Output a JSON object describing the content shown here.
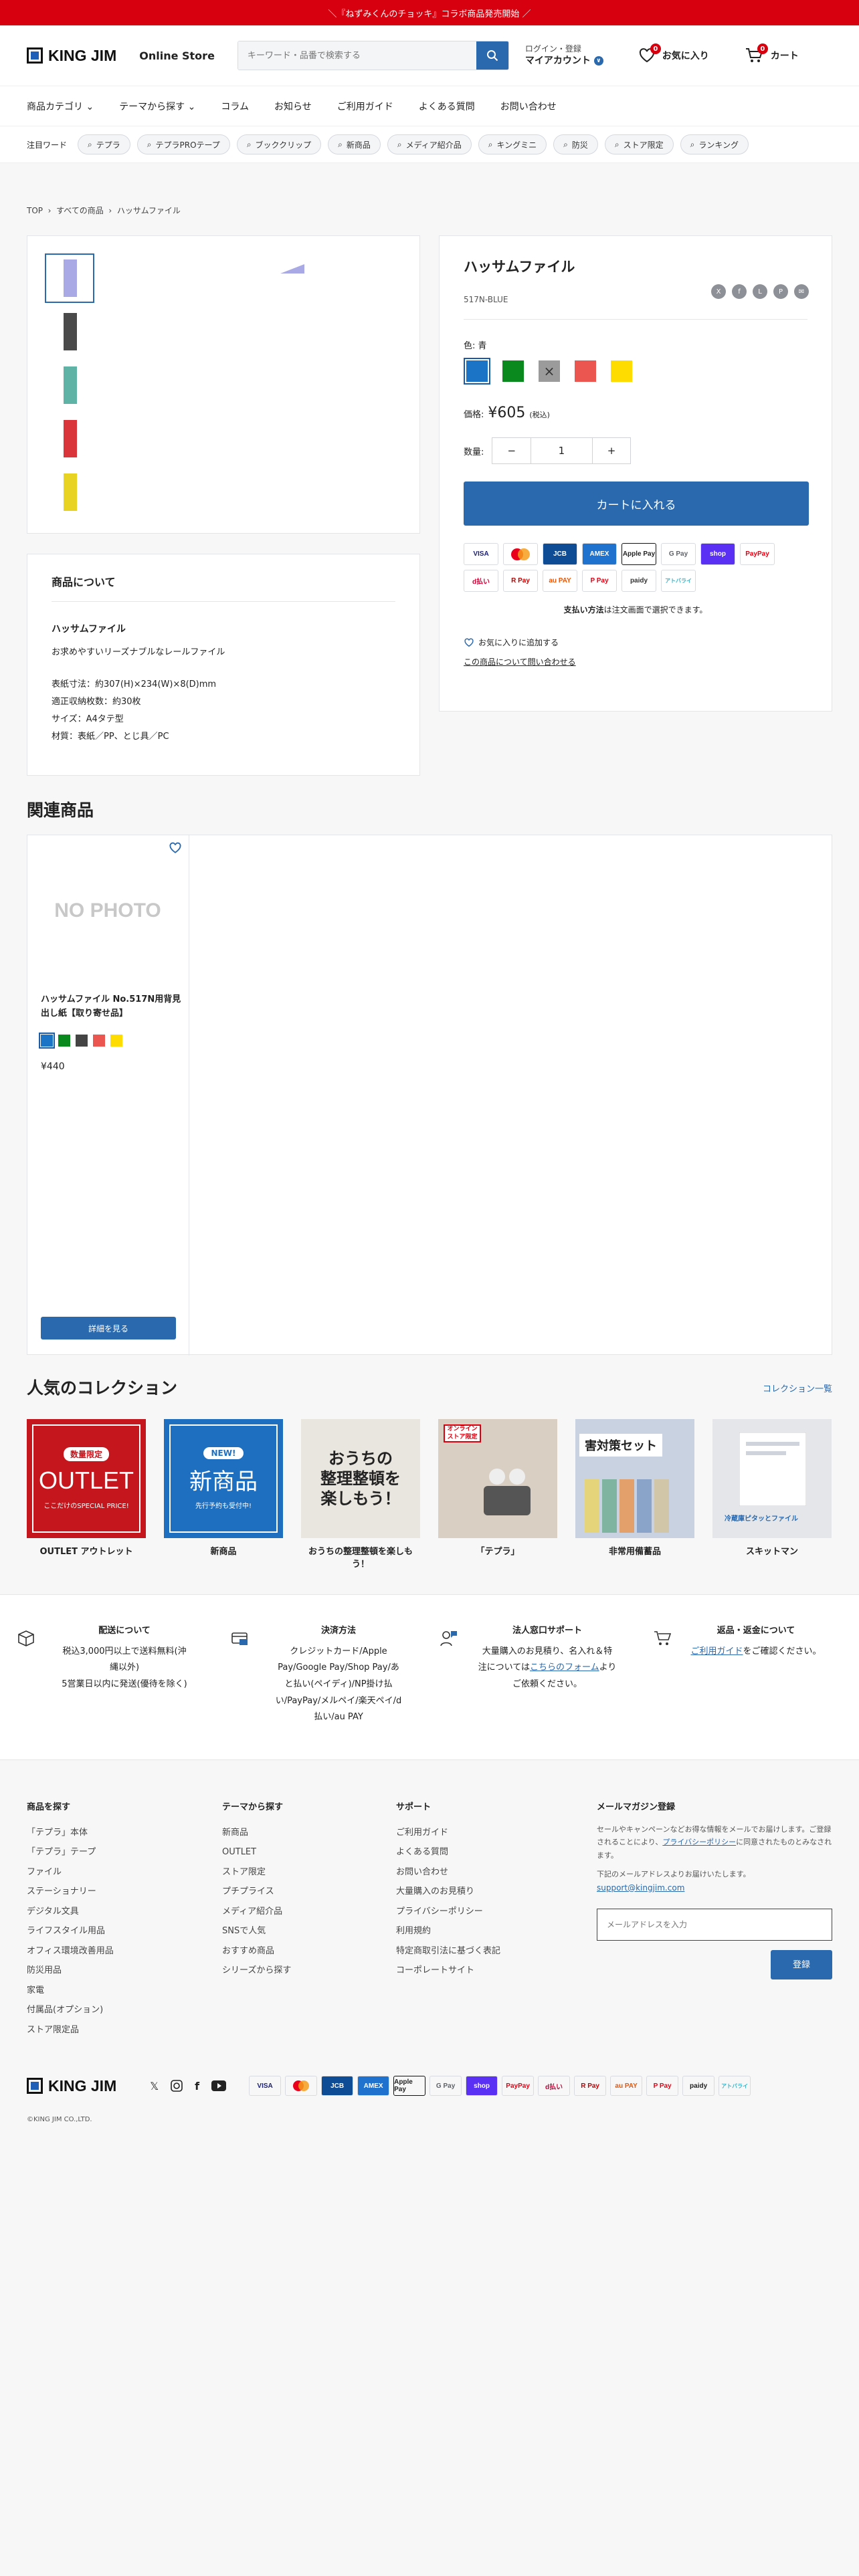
{
  "announcement": "＼『ねずみくんのチョッキ』コラボ商品発売開始 ／",
  "header": {
    "brand": "KING JIM",
    "store": "Online Store",
    "search_placeholder": "キーワード・品番で検索する",
    "account_line1": "ログイン・登録",
    "account_line2": "マイアカウント",
    "account_badge": "∨",
    "wishlist_label": "お気に入り",
    "wishlist_count": "0",
    "cart_label": "カート",
    "cart_count": "0"
  },
  "nav": [
    "商品カテゴリ",
    "テーマから探す",
    "コラム",
    "お知らせ",
    "ご利用ガイド",
    "よくある質問",
    "お問い合わせ"
  ],
  "keywords": {
    "label": "注目ワード",
    "items": [
      "テプラ",
      "テプラPROテープ",
      "ブッククリップ",
      "新商品",
      "メディア紹介品",
      "キングミニ",
      "防災",
      "ストア限定",
      "ランキング"
    ]
  },
  "breadcrumb": [
    "TOP",
    "すべての商品",
    "ハッサムファイル"
  ],
  "product": {
    "title": "ハッサムファイル",
    "sku": "517N-BLUE",
    "color_label": "色: 青",
    "price_label": "価格:",
    "price": "¥605",
    "tax": "(税込)",
    "qty_label": "数量:",
    "qty": "1",
    "add_to_cart": "カートに入れる",
    "payment_note_bold": "支払い方法",
    "payment_note": "は注文画面で選択できます。",
    "add_favorite": "お気に入りに追加する",
    "inquiry": "この商品について問い合わせる",
    "swatches": [
      {
        "color": "#1b74c6",
        "selected": true
      },
      {
        "color": "#0a8a1e"
      },
      {
        "color": "#9b9b9b",
        "soldout": true
      },
      {
        "color": "#ec5650"
      },
      {
        "color": "#ffdc00"
      }
    ],
    "thumb_colors": [
      "#a9a9e6",
      "#4a4a4a",
      "#5fb3a6",
      "#d9353b",
      "#e8d322"
    ],
    "payment_icons": [
      "VISA",
      "MC",
      "JCB",
      "AMEX",
      "Apple Pay",
      "G Pay",
      "shop",
      "PayPay",
      "d払い",
      "R Pay",
      "au PAY",
      "P Pay",
      "paidy",
      "アトバライ"
    ]
  },
  "about": {
    "heading": "商品について",
    "name": "ハッサムファイル",
    "desc": "お求めやすいリーズナブルなレールファイル",
    "spec1": "表紙寸法：約307(H)×234(W)×8(D)mm",
    "spec2": "適正収納枚数：約30枚",
    "spec3": "サイズ：A4タテ型",
    "spec4": "材質：表紙／PP、とじ具／PC"
  },
  "related": {
    "heading": "関連商品",
    "noimg": "NO PHOTO",
    "name": "ハッサムファイル No.517N用背見出し紙【取り寄せ品】",
    "price": "¥440",
    "button": "詳細を見る",
    "swatches": [
      "#1b74c6",
      "#0a8a1e",
      "#444444",
      "#ec5650",
      "#ffdc00"
    ]
  },
  "collections": {
    "heading": "人気のコレクション",
    "all": "コレクション一覧",
    "items": [
      {
        "name": "OUTLET アウトレット",
        "img1": "数量限定",
        "img2": "OUTLET",
        "img3": "ここだけのSPECIAL PRICE!"
      },
      {
        "name": "新商品",
        "img1": "NEW!",
        "img2": "新商品",
        "img3": "先行予約も受付中!"
      },
      {
        "name": "おうちの整理整頓を楽しもう！",
        "img1": "おうちの",
        "img2": "整理整頓を",
        "img3": "楽しもう！"
      },
      {
        "name": "「テプラ」",
        "img1": "オンラインストア限定"
      },
      {
        "name": "非常用備蓄品",
        "img1": "害対策セット"
      },
      {
        "name": "スキットマン",
        "img1": "冷蔵庫ピタッとファイル"
      }
    ]
  },
  "services": [
    {
      "title": "配送について",
      "l1": "税込3,000円以上で送料無料(沖",
      "l2": "縄以外)",
      "l3": "5営業日以内に発送(優待を除く)"
    },
    {
      "title": "決済方法",
      "l1": "クレジットカード/Apple",
      "l2": "Pay/Google Pay/Shop Pay/あ",
      "l3": "と払い(ペイディ)/NP掛け払",
      "l4": "い/PayPay/メルペイ/楽天ペイ/d",
      "l5": "払い/au PAY"
    },
    {
      "title": "法人窓口サポート",
      "l1": "大量購入のお見積り、名入れ＆特",
      "l2a": "注については",
      "link": "こちらのフォーム",
      "l2b": "より",
      "l3": "ご依頼ください。"
    },
    {
      "title": "返品・返金について",
      "link": "ご利用ガイド",
      "l1": "をご確認ください。"
    }
  ],
  "footer": {
    "c1": {
      "title": "商品を探す",
      "items": [
        "「テプラ」本体",
        "「テプラ」テープ",
        "ファイル",
        "ステーショナリー",
        "デジタル文具",
        "ライフスタイル用品",
        "オフィス環境改善用品",
        "防災用品",
        "家電",
        "付属品(オプション)",
        "ストア限定品"
      ]
    },
    "c2": {
      "title": "テーマから探す",
      "items": [
        "新商品",
        "OUTLET",
        "ストア限定",
        "プチプライス",
        "メディア紹介品",
        "SNSで人気",
        "おすすめ商品",
        "シリーズから探す"
      ]
    },
    "c3": {
      "title": "サポート",
      "items": [
        "ご利用ガイド",
        "よくある質問",
        "お問い合わせ",
        "大量購入のお見積り",
        "プライバシーポリシー",
        "利用規約",
        "特定商取引法に基づく表記",
        "コーポレートサイト"
      ]
    },
    "news": {
      "title": "メールマガジン登録",
      "t1": "セールやキャンペーンなどお得な情報をメールでお届けします。ご登録されることにより、",
      "policy": "プライバシーポリシー",
      "t2": "に同意されたものとみなされます。",
      "t3": "下記のメールアドレスよりお届けいたします。",
      "email": "support@kingjim.com",
      "placeholder": "メールアドレスを入力",
      "submit": "登録"
    },
    "copyright": "©KING JIM CO.,LTD."
  }
}
